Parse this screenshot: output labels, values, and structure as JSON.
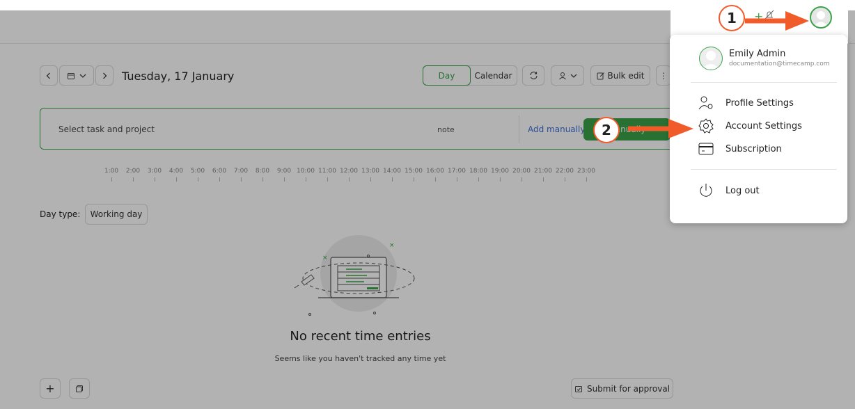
{
  "date_nav": {
    "title": "Tuesday, 17 January"
  },
  "view_toggle": {
    "day_label": "Day",
    "calendar_label": "Calendar"
  },
  "toolbar": {
    "bulk_edit_label": "Bulk edit"
  },
  "tracker": {
    "task_placeholder": "Select task and project",
    "note_placeholder": "note",
    "add_manually_label": "Add manually",
    "start_label": "Manually"
  },
  "timeline": {
    "ticks": [
      "1:00",
      "2:00",
      "3:00",
      "4:00",
      "5:00",
      "6:00",
      "7:00",
      "8:00",
      "9:00",
      "10:00",
      "11:00",
      "12:00",
      "13:00",
      "14:00",
      "15:00",
      "16:00",
      "17:00",
      "18:00",
      "19:00",
      "20:00",
      "21:00",
      "22:00",
      "23:00"
    ]
  },
  "day_type": {
    "label": "Day type:",
    "value": "Working day"
  },
  "empty_state": {
    "title": "No recent time entries",
    "subtitle": "Seems like you haven't tracked any time yet"
  },
  "footer": {
    "submit_label": "Submit for approval"
  },
  "user_menu": {
    "name": "Emily Admin",
    "email": "documentation@timecamp.com",
    "items": [
      {
        "label": "Profile Settings",
        "icon": "profile-settings-icon"
      },
      {
        "label": "Account Settings",
        "icon": "gear-icon"
      },
      {
        "label": "Subscription",
        "icon": "card-icon"
      },
      {
        "label": "Log out",
        "icon": "power-icon"
      }
    ]
  },
  "annotations": {
    "step1": "1",
    "step2": "2"
  },
  "colors": {
    "accent": "#3aa34a",
    "annotation": "#f15a29",
    "link": "#3b6fd6"
  }
}
